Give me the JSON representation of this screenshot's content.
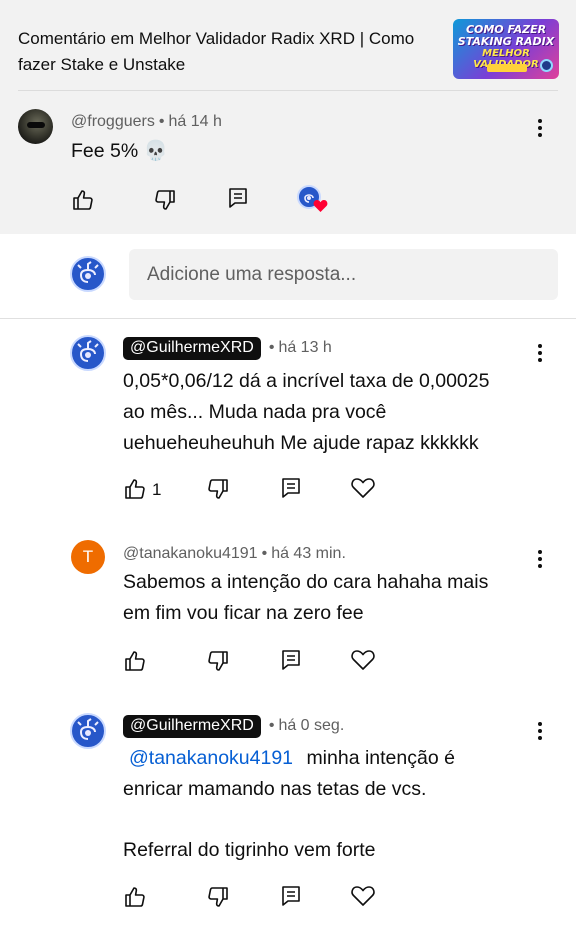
{
  "header": {
    "video_title": "Comentário em Melhor Validador Radix XRD | Como fazer Stake e Unstake",
    "thumbnail": {
      "line1": "COMO FAZER",
      "line2": "STAKING RADIX",
      "line3": "MELHOR VALIDADOR"
    }
  },
  "top_comment": {
    "author": "@frogguers",
    "time": "há 14 h",
    "text": "Fee 5% 💀"
  },
  "reply_input": {
    "placeholder": "Adicione uma resposta..."
  },
  "replies": [
    {
      "author": "@GuilhermeXRD",
      "author_is_creator": true,
      "time": "há 13 h",
      "text_lines": [
        "0,05*0,06/12 dá a incrível taxa de 0,00025",
        "ao mês... Muda nada pra você",
        "uehueheuheuhuh Me ajude rapaz kkkkkk"
      ],
      "like_count": "1"
    },
    {
      "author": "@tanakanoku4191",
      "avatar_letter": "T",
      "time": "há 43 min.",
      "text_lines": [
        "Sabemos a intenção do cara hahaha mais",
        "em fim vou ficar na zero fee"
      ]
    },
    {
      "author": "@GuilhermeXRD",
      "author_is_creator": true,
      "time": "há 0 seg.",
      "mention": "@tanakanoku4191",
      "text_line1_rest": "minha intenção é",
      "text_line2": "enricar mamando nas tetas de vcs.",
      "text_line3": "Referral do tigrinho vem forte"
    }
  ],
  "sep": "•",
  "icons": [
    "like-icon",
    "dislike-icon",
    "reply-icon",
    "heart-icon",
    "more-icon"
  ],
  "colors": {
    "mention": "#065fd4",
    "heart": "#ff0033",
    "avatar_t": "#ef6c00",
    "creator_chip": "#0f0f0f"
  }
}
